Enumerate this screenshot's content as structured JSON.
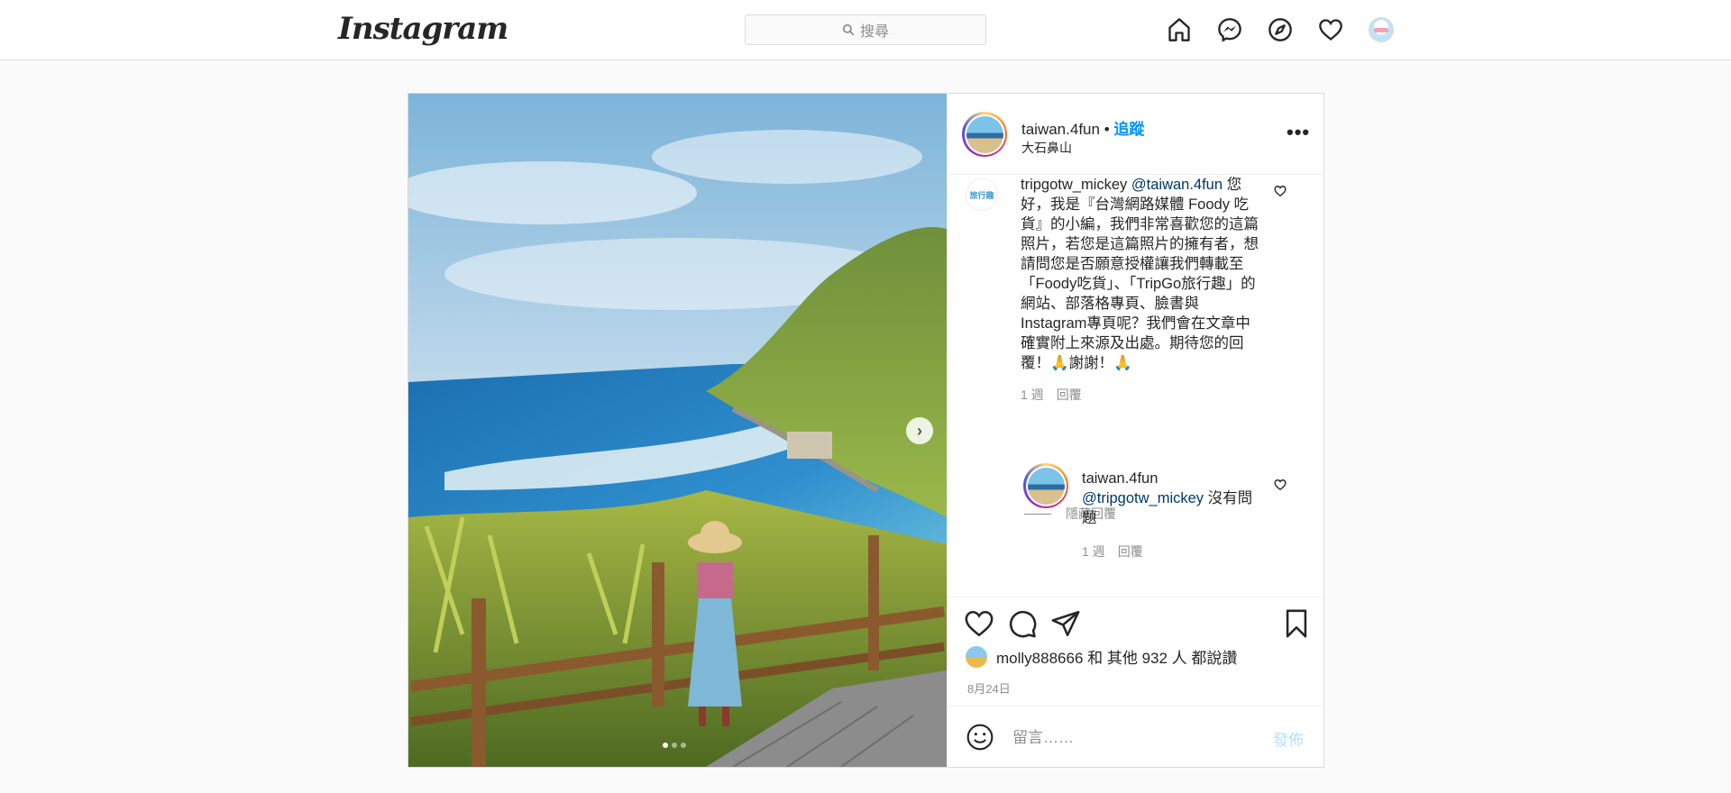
{
  "nav": {
    "logo": "Instagram",
    "search_placeholder": "搜尋",
    "icons": [
      "home-icon",
      "messenger-icon",
      "explore-icon",
      "activity-heart-icon",
      "profile-avatar"
    ]
  },
  "post": {
    "author": "taiwan.4fun",
    "follow_label": "追蹤",
    "separator": "•",
    "location": "大石鼻山",
    "more_label": "•••",
    "carousel": {
      "slides": 3,
      "active": 1
    }
  },
  "comments": [
    {
      "user": "tripgotw_mickey",
      "mention": "@taiwan.4fun",
      "text": " 您好，我是『台灣網路媒體 Foody 吃貨』的小編，我們非常喜歡您的這篇照片，若您是這篇照片的擁有者，想請問您是否願意授權讓我們轉載至「Foody吃貨」、「TripGo旅行趣」的網站、部落格專頁、臉書與Instagram專頁呢？我們會在文章中確實附上來源及出處。期待您的回覆！🙏謝謝！🙏",
      "time": "1 週",
      "reply_label": "回覆",
      "avatar_text": "旅行趣"
    }
  ],
  "hide_replies_label": "隱藏回覆",
  "replies": [
    {
      "user": "taiwan.4fun",
      "mention": "@tripgotw_mickey",
      "text": " 沒有問題",
      "time": "1 週",
      "reply_label": "回覆"
    }
  ],
  "likes": {
    "user": "molly888666",
    "joiner": "和",
    "others": "其他 932 人",
    "suffix": "都說讚"
  },
  "date": "8月24日",
  "comment_box": {
    "placeholder": "留言……",
    "post_label": "發佈"
  },
  "colors": {
    "accent": "#0095f6",
    "mention": "#00376b",
    "post_disabled": "#b2dffc",
    "border": "#dbdbdb",
    "muted": "#8e8e8e"
  }
}
